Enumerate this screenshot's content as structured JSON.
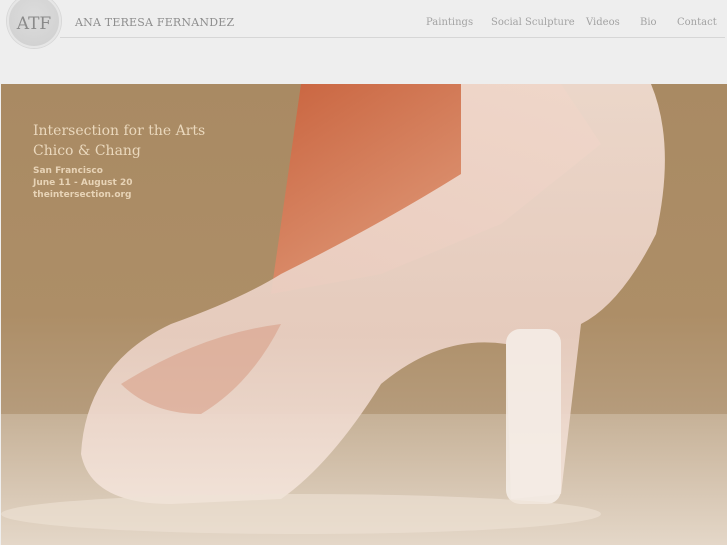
{
  "header": {
    "logo_text": "ATF",
    "site_title": "ANA TERESA FERNANDEZ",
    "nav": [
      "Paintings",
      "Social Sculpture",
      "Videos",
      "Bio",
      "Contact"
    ]
  },
  "hero": {
    "promo": {
      "title_line1": "Intersection for the Arts",
      "title_line2": "Chico & Chang",
      "city": "San Francisco",
      "dates": "June 11  - August 20",
      "url": "theintersection.org"
    }
  }
}
